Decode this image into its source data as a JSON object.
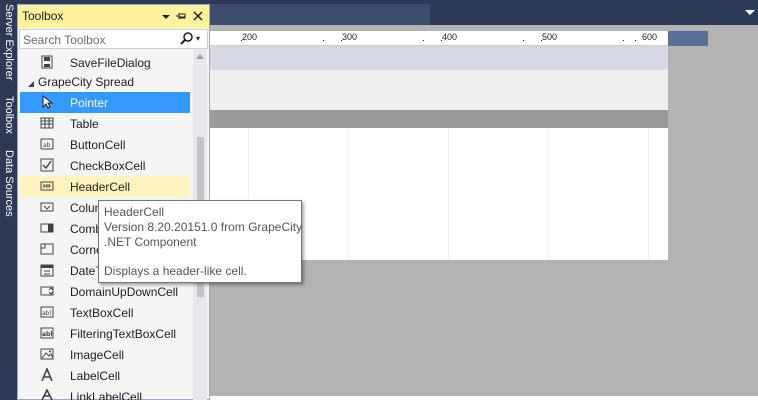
{
  "side_tabs": [
    "Server Explorer",
    "Toolbox",
    "Data Sources"
  ],
  "toolbox": {
    "title": "Toolbox",
    "search_placeholder": "Search Toolbox",
    "items": [
      {
        "label": "SaveFileDialog",
        "icon": "save-file-dialog-icon"
      },
      {
        "label": "GrapeCity Spread",
        "group": true
      },
      {
        "label": "Pointer",
        "icon": "pointer-icon",
        "selected": true
      },
      {
        "label": "Table",
        "icon": "table-icon"
      },
      {
        "label": "ButtonCell",
        "icon": "button-cell-icon"
      },
      {
        "label": "CheckBoxCell",
        "icon": "checkbox-cell-icon"
      },
      {
        "label": "HeaderCell",
        "icon": "header-cell-icon",
        "hover": true
      },
      {
        "label": "ColumnHeaderCell",
        "icon": "column-header-cell-icon"
      },
      {
        "label": "ComboBoxCell",
        "icon": "combobox-cell-icon"
      },
      {
        "label": "CornerCell",
        "icon": "corner-cell-icon"
      },
      {
        "label": "DateTimeCell",
        "icon": "datetime-cell-icon"
      },
      {
        "label": "DomainUpDownCell",
        "icon": "domain-updown-cell-icon"
      },
      {
        "label": "TextBoxCell",
        "icon": "textbox-cell-icon"
      },
      {
        "label": "FilteringTextBoxCell",
        "icon": "filtering-textbox-cell-icon"
      },
      {
        "label": "ImageCell",
        "icon": "image-cell-icon"
      },
      {
        "label": "LabelCell",
        "icon": "label-cell-icon"
      },
      {
        "label": "LinkLabelCell",
        "icon": "link-label-cell-icon"
      }
    ]
  },
  "ruler": {
    "labels": [
      "200",
      "300",
      "400",
      "500",
      "600"
    ]
  },
  "tooltip": {
    "title": "HeaderCell",
    "version": "Version 8.20.20151.0 from GrapeCity",
    "component": ".NET Component",
    "description": "Displays a header-like cell."
  },
  "colors": {
    "chrome": "#2d3a57",
    "toolbox_header": "#fff29d",
    "selected": "#3399ff",
    "hover": "#fff4bf",
    "designer_background": "#b3b3b3"
  }
}
